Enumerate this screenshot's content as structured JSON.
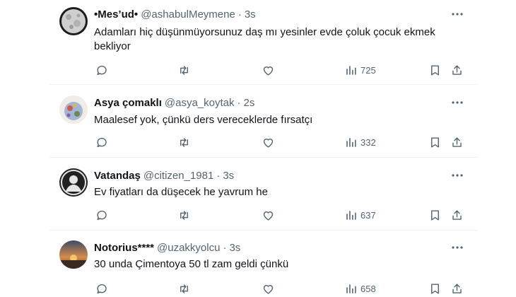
{
  "tweets": [
    {
      "name": "•Mes’ud•",
      "handle": "@ashabulMeymene",
      "separator": "·",
      "time": "3s",
      "text": "Adamları hiç düşünmüyorsunuz daş mı yesinler evde çoluk çocuk ekmek bekliyor",
      "views": "725",
      "avatar_icon": "moon-avatar"
    },
    {
      "name": "Asya çomaklı",
      "handle": "@asya_koytak",
      "separator": "·",
      "time": "2s",
      "text": "Maalesef yok, çünkü ders vereceklerde fırsatçı",
      "views": "332",
      "avatar_icon": "globe-avatar"
    },
    {
      "name": "Vatandaş",
      "handle": "@citizen_1981",
      "separator": "·",
      "time": "3s",
      "text": "Ev fiyatları da düşecek he yavrum he",
      "views": "637",
      "avatar_icon": "portrait-avatar"
    },
    {
      "name": "Notorius****",
      "handle": "@uzakkyolcu",
      "separator": "·",
      "time": "3s",
      "text": "30 unda Çimentoya 50 tl zam geldi çünkü",
      "views": "658",
      "avatar_icon": "sunset-avatar"
    }
  ],
  "colors": {
    "text": "#0f1419",
    "secondary": "#536471",
    "border": "#eff3f4"
  }
}
